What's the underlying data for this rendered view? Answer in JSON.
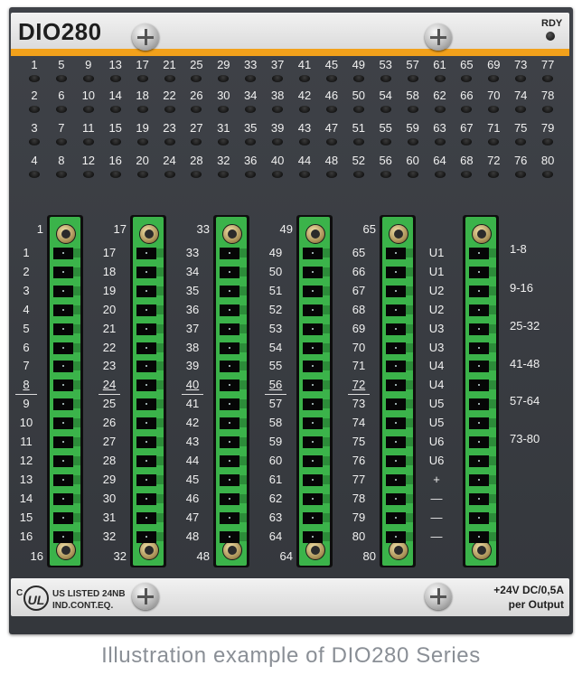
{
  "module": {
    "name": "DIO280",
    "rdy_label": "RDY",
    "led_grid": [
      [
        "1",
        "5",
        "9",
        "13",
        "17",
        "21",
        "25",
        "29",
        "33",
        "37",
        "41",
        "45",
        "49",
        "53",
        "57",
        "61",
        "65",
        "69",
        "73",
        "77"
      ],
      [
        "2",
        "6",
        "10",
        "14",
        "18",
        "22",
        "26",
        "30",
        "34",
        "38",
        "42",
        "46",
        "50",
        "54",
        "58",
        "62",
        "66",
        "70",
        "74",
        "78"
      ],
      [
        "3",
        "7",
        "11",
        "15",
        "19",
        "23",
        "27",
        "31",
        "35",
        "39",
        "43",
        "47",
        "51",
        "55",
        "59",
        "63",
        "67",
        "71",
        "75",
        "79"
      ],
      [
        "4",
        "8",
        "12",
        "16",
        "20",
        "24",
        "28",
        "32",
        "36",
        "40",
        "44",
        "48",
        "52",
        "56",
        "60",
        "64",
        "68",
        "72",
        "76",
        "80"
      ]
    ],
    "terminals": [
      {
        "top": "1",
        "bottom": "16",
        "rows": [
          "1",
          "2",
          "3",
          "4",
          "5",
          "6",
          "7",
          "8",
          "9",
          "10",
          "11",
          "12",
          "13",
          "14",
          "15",
          "16"
        ]
      },
      {
        "top": "17",
        "bottom": "32",
        "rows": [
          "17",
          "18",
          "19",
          "20",
          "21",
          "22",
          "23",
          "24",
          "25",
          "26",
          "27",
          "28",
          "29",
          "30",
          "31",
          "32"
        ]
      },
      {
        "top": "33",
        "bottom": "48",
        "rows": [
          "33",
          "34",
          "35",
          "36",
          "37",
          "38",
          "39",
          "40",
          "41",
          "42",
          "43",
          "44",
          "45",
          "46",
          "47",
          "48"
        ]
      },
      {
        "top": "49",
        "bottom": "64",
        "rows": [
          "49",
          "50",
          "51",
          "52",
          "53",
          "54",
          "55",
          "56",
          "57",
          "58",
          "59",
          "60",
          "61",
          "62",
          "63",
          "64"
        ]
      },
      {
        "top": "65",
        "bottom": "80",
        "rows": [
          "65",
          "66",
          "67",
          "68",
          "69",
          "70",
          "71",
          "72",
          "73",
          "74",
          "75",
          "76",
          "77",
          "78",
          "79",
          "80"
        ]
      },
      {
        "top": "",
        "bottom": "",
        "rows": [
          "U1",
          "U1",
          "U2",
          "U2",
          "U3",
          "U3",
          "U4",
          "U4",
          "U5",
          "U5",
          "U6",
          "U6",
          "+",
          "—",
          "—",
          "—"
        ]
      }
    ],
    "group_labels": [
      "1-8",
      "9-16",
      "25-32",
      "41-48",
      "57-64",
      "73-80"
    ],
    "certification": {
      "c_mark": "C",
      "ul_mark": "UL",
      "us_mark": "US",
      "line1": "LISTED 24NB",
      "line2": "IND.CONT.EQ."
    },
    "power": {
      "line1": "+24V DC/0,5A",
      "line2": "per Output"
    }
  },
  "caption": "Illustration example of DIO280 Series"
}
